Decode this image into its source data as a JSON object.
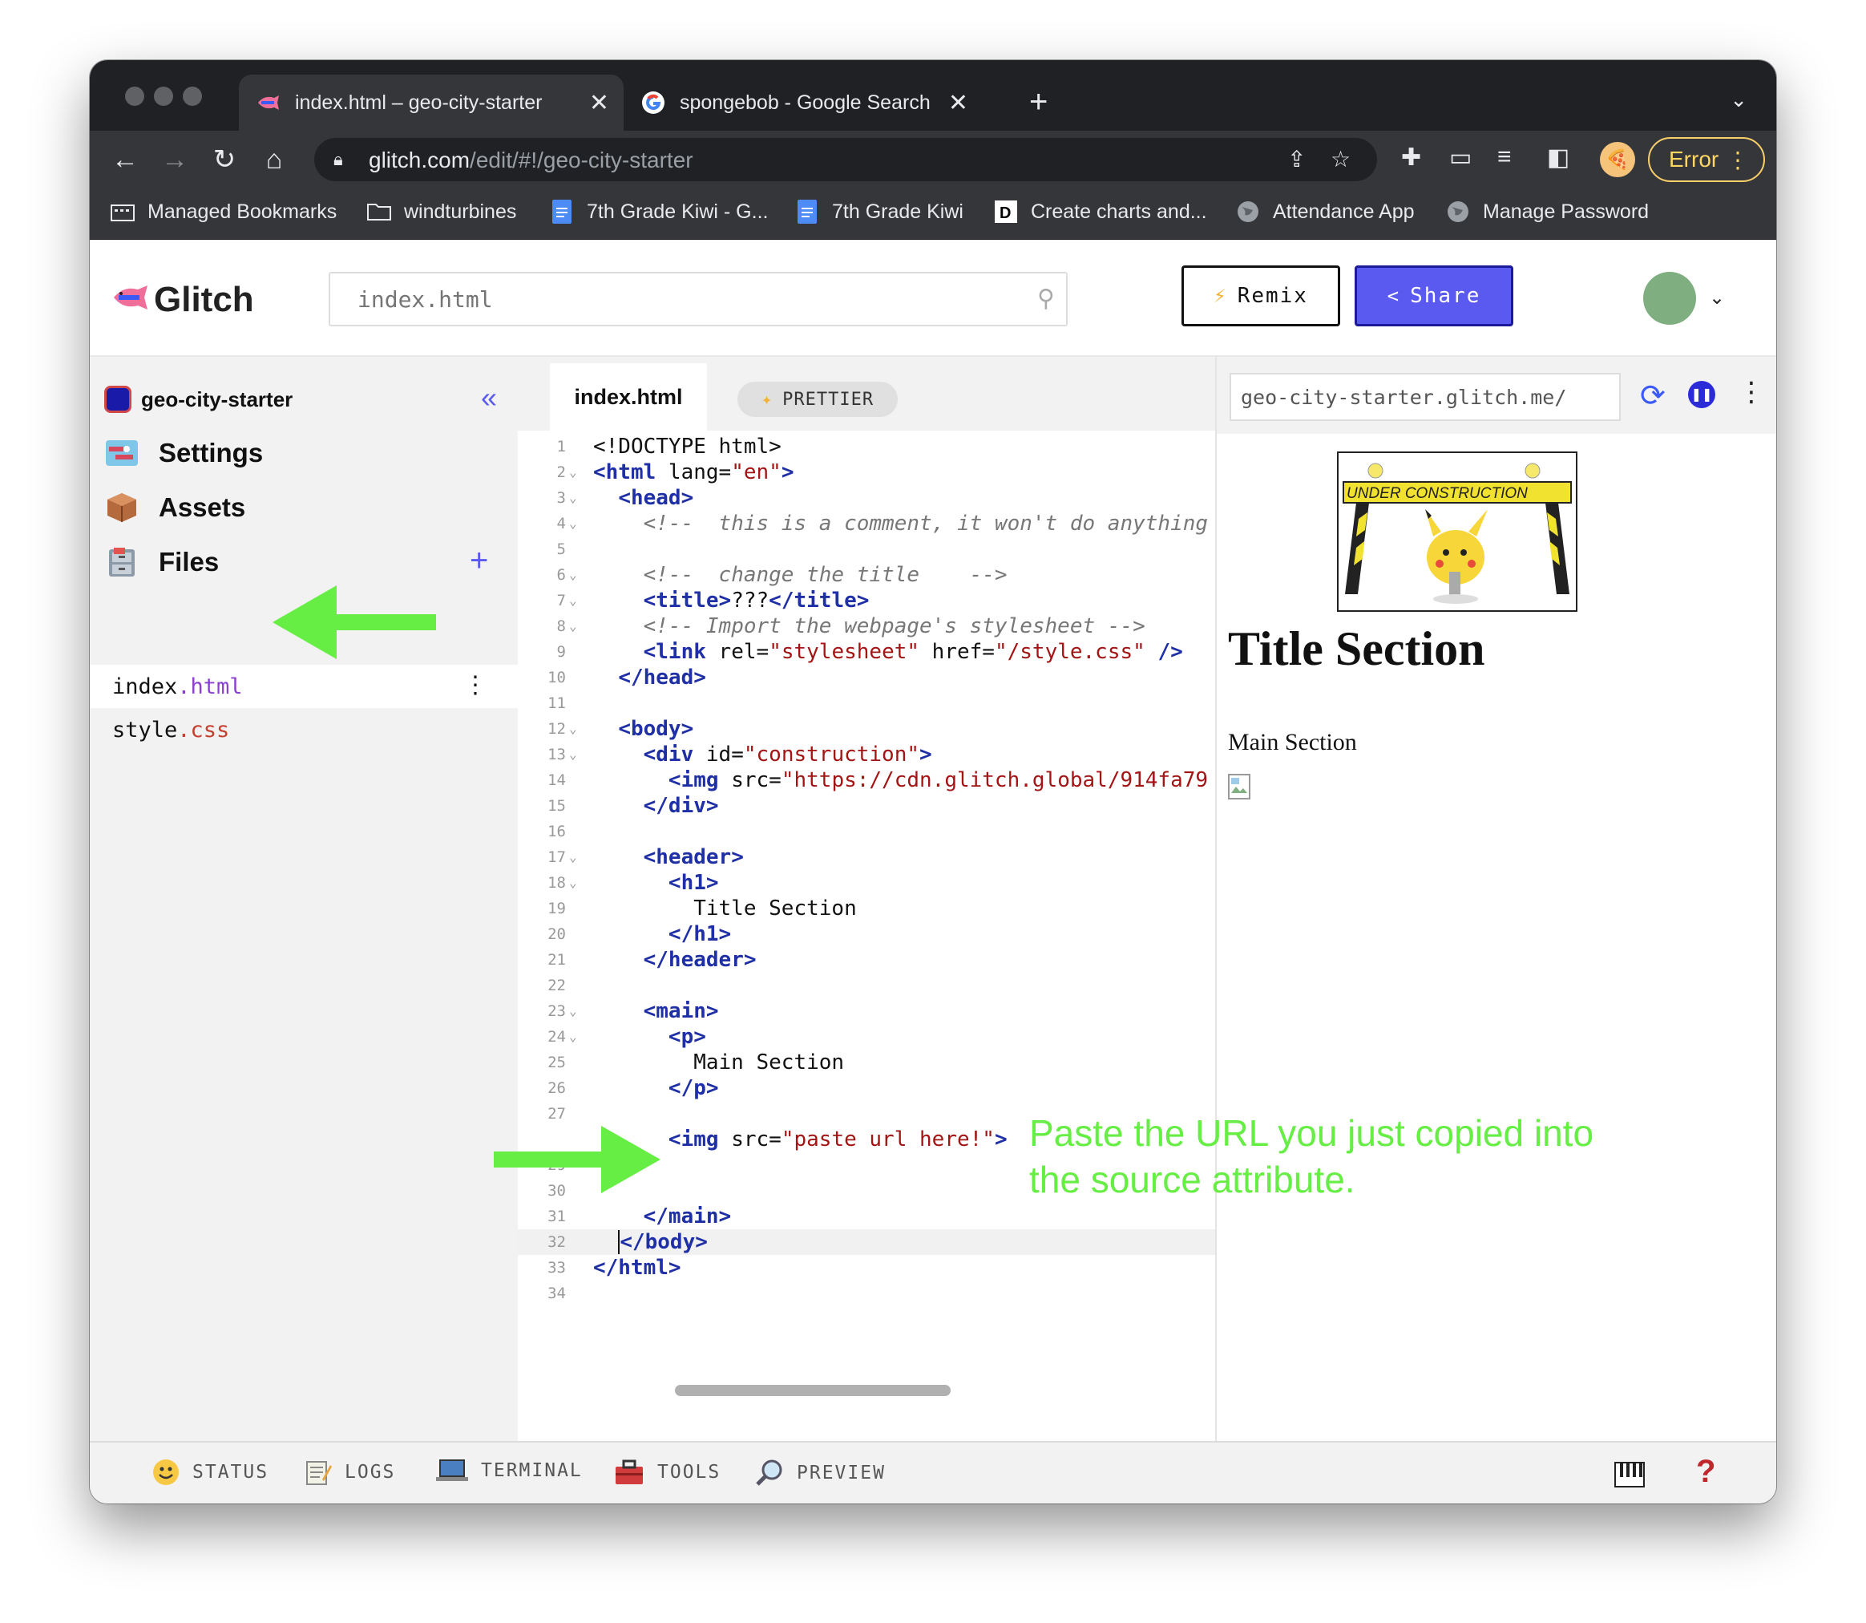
{
  "browser": {
    "tabs": [
      {
        "title": "index.html – geo-city-starter",
        "active": true
      },
      {
        "title": "spongebob - Google Search",
        "active": false
      }
    ],
    "url": {
      "host": "glitch.com",
      "path": "/edit/#!/geo-city-starter"
    },
    "profile_status": "Error",
    "bookmarks": [
      {
        "label": "Managed Bookmarks",
        "icon": "folder-icon"
      },
      {
        "label": "windturbines",
        "icon": "folder-icon"
      },
      {
        "label": "7th Grade Kiwi - G...",
        "icon": "docs-icon"
      },
      {
        "label": "7th Grade Kiwi",
        "icon": "docs-icon"
      },
      {
        "label": "Create charts and...",
        "icon": "d-logo-icon"
      },
      {
        "label": "Attendance App",
        "icon": "globe-icon"
      },
      {
        "label": "Manage Password",
        "icon": "globe-icon"
      }
    ]
  },
  "glitch": {
    "logo": "Glitch",
    "search_placeholder": "index.html",
    "remix_label": "Remix",
    "share_label": "Share",
    "accent": "#5a5af0"
  },
  "sidebar": {
    "project": "geo-city-starter",
    "nav": [
      {
        "label": "Settings",
        "icon": "settings-icon"
      },
      {
        "label": "Assets",
        "icon": "box-icon"
      },
      {
        "label": "Files",
        "icon": "file-cabinet-icon"
      }
    ],
    "files": [
      {
        "name": "index",
        "ext": ".html",
        "selected": true
      },
      {
        "name": "style",
        "ext": ".css",
        "selected": false
      }
    ]
  },
  "editor": {
    "tab": "index.html",
    "prettier": "PRETTIER",
    "lines": [
      {
        "n": "1",
        "tokens": [
          [
            "tx",
            "<!DOCTYPE html>"
          ]
        ]
      },
      {
        "n": "2",
        "fold": true,
        "tokens": [
          [
            "tg",
            "<html"
          ],
          [
            "at",
            " lang="
          ],
          [
            "st",
            "\"en\""
          ],
          [
            "tg",
            ">"
          ]
        ]
      },
      {
        "n": "3",
        "fold": true,
        "tokens": [
          [
            "tx",
            "  "
          ],
          [
            "tg",
            "<head>"
          ]
        ]
      },
      {
        "n": "4",
        "fold": true,
        "tokens": [
          [
            "tx",
            "    "
          ],
          [
            "cm",
            "<!--  this is a comment, it won't do anything"
          ]
        ]
      },
      {
        "n": "5",
        "tokens": []
      },
      {
        "n": "6",
        "fold": true,
        "tokens": [
          [
            "tx",
            "    "
          ],
          [
            "cm",
            "<!--  change the title    -->"
          ]
        ]
      },
      {
        "n": "7",
        "fold": true,
        "tokens": [
          [
            "tx",
            "    "
          ],
          [
            "tg",
            "<title>"
          ],
          [
            "tx",
            "???"
          ],
          [
            "tg",
            "</title>"
          ]
        ]
      },
      {
        "n": "8",
        "fold": true,
        "tokens": [
          [
            "tx",
            "    "
          ],
          [
            "cm",
            "<!-- Import the webpage's stylesheet -->"
          ]
        ]
      },
      {
        "n": "9",
        "tokens": [
          [
            "tx",
            "    "
          ],
          [
            "tg",
            "<link"
          ],
          [
            "at",
            " rel="
          ],
          [
            "st",
            "\"stylesheet\""
          ],
          [
            "at",
            " href="
          ],
          [
            "st",
            "\"/style.css\""
          ],
          [
            "tg",
            " />"
          ]
        ]
      },
      {
        "n": "10",
        "tokens": [
          [
            "tx",
            "  "
          ],
          [
            "tg",
            "</head>"
          ]
        ]
      },
      {
        "n": "11",
        "tokens": []
      },
      {
        "n": "12",
        "fold": true,
        "tokens": [
          [
            "tx",
            "  "
          ],
          [
            "tg",
            "<body>"
          ]
        ]
      },
      {
        "n": "13",
        "fold": true,
        "tokens": [
          [
            "tx",
            "    "
          ],
          [
            "tg",
            "<div"
          ],
          [
            "at",
            " id="
          ],
          [
            "st",
            "\"construction\""
          ],
          [
            "tg",
            ">"
          ]
        ]
      },
      {
        "n": "14",
        "tokens": [
          [
            "tx",
            "      "
          ],
          [
            "tg",
            "<img"
          ],
          [
            "at",
            " src="
          ],
          [
            "st",
            "\"https://cdn.glitch.global/914fa79"
          ]
        ]
      },
      {
        "n": "15",
        "tokens": [
          [
            "tx",
            "    "
          ],
          [
            "tg",
            "</div>"
          ]
        ]
      },
      {
        "n": "16",
        "tokens": []
      },
      {
        "n": "17",
        "fold": true,
        "tokens": [
          [
            "tx",
            "    "
          ],
          [
            "tg",
            "<header>"
          ]
        ]
      },
      {
        "n": "18",
        "fold": true,
        "tokens": [
          [
            "tx",
            "      "
          ],
          [
            "tg",
            "<h1>"
          ]
        ]
      },
      {
        "n": "19",
        "tokens": [
          [
            "tx",
            "        Title Section"
          ]
        ]
      },
      {
        "n": "20",
        "tokens": [
          [
            "tx",
            "      "
          ],
          [
            "tg",
            "</h1>"
          ]
        ]
      },
      {
        "n": "21",
        "tokens": [
          [
            "tx",
            "    "
          ],
          [
            "tg",
            "</header>"
          ]
        ]
      },
      {
        "n": "22",
        "tokens": []
      },
      {
        "n": "23",
        "fold": true,
        "tokens": [
          [
            "tx",
            "    "
          ],
          [
            "tg",
            "<main>"
          ]
        ]
      },
      {
        "n": "24",
        "fold": true,
        "tokens": [
          [
            "tx",
            "      "
          ],
          [
            "tg",
            "<p>"
          ]
        ]
      },
      {
        "n": "25",
        "tokens": [
          [
            "tx",
            "        Main Section"
          ]
        ]
      },
      {
        "n": "26",
        "tokens": [
          [
            "tx",
            "      "
          ],
          [
            "tg",
            "</p>"
          ]
        ]
      },
      {
        "n": "27",
        "tokens": []
      },
      {
        "n": "",
        "tokens": [
          [
            "tx",
            "      "
          ],
          [
            "tg",
            "<img"
          ],
          [
            "at",
            " src="
          ],
          [
            "st",
            "\"paste url here!\""
          ],
          [
            "tg",
            ">"
          ]
        ]
      },
      {
        "n": "29",
        "tokens": []
      },
      {
        "n": "30",
        "tokens": []
      },
      {
        "n": "31",
        "tokens": [
          [
            "tx",
            "    "
          ],
          [
            "tg",
            "</main>"
          ]
        ]
      },
      {
        "n": "32",
        "current": true,
        "tokens": [
          [
            "tx",
            "  "
          ],
          [
            "caret",
            ""
          ],
          [
            "tg",
            "</body>"
          ]
        ]
      },
      {
        "n": "33",
        "tokens": [
          [
            "tg",
            "</html>"
          ]
        ]
      },
      {
        "n": "34",
        "tokens": []
      }
    ]
  },
  "preview": {
    "url": "geo-city-starter.glitch.me/",
    "banner_text": "UNDER CONSTRUCTION",
    "title": "Title Section",
    "main": "Main Section"
  },
  "statusbar": {
    "items": [
      {
        "label": "STATUS",
        "icon": "smiley-icon"
      },
      {
        "label": "LOGS",
        "icon": "notepad-icon"
      },
      {
        "label": "TERMINAL",
        "icon": "laptop-icon"
      },
      {
        "label": "TOOLS",
        "icon": "toolbox-icon"
      },
      {
        "label": "PREVIEW",
        "icon": "magnifier-icon"
      }
    ],
    "help": "?"
  },
  "annotation": {
    "text": "Paste the URL you just copied into the source attribute.",
    "color": "#66ee44"
  }
}
